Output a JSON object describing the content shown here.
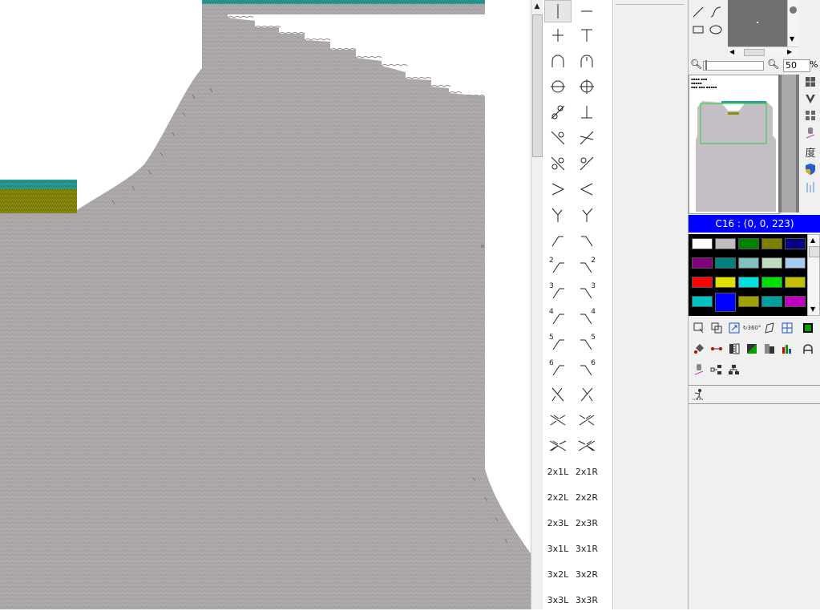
{
  "zoom": {
    "value": "50",
    "unit": "%"
  },
  "current_color": {
    "label": "C16 : (0, 0, 223)"
  },
  "symbol_palette": {
    "text_symbols": [
      "2x1L",
      "2x1R",
      "2x2L",
      "2x2R",
      "2x3L",
      "2x3R",
      "3x1L",
      "3x1R",
      "3x2L",
      "3x2R",
      "3x3L",
      "3x3R"
    ],
    "number_symbols": [
      "2",
      "2",
      "3",
      "3",
      "4",
      "4",
      "5",
      "5",
      "6",
      "6"
    ]
  },
  "side_tools": {
    "degree_label": "度"
  },
  "swatches": [
    "#ffffff",
    "#c0bcc0",
    "#008000",
    "#808000",
    "#000080",
    "#800080",
    "#008080",
    "#80c0c0",
    "#c0dcc0",
    "#a6caf0",
    "#ff0000",
    "#e0e000",
    "#00e0e0",
    "#00e000",
    "#c0c000",
    "#00c0c0",
    "#0000ff",
    "#a0a000",
    "#00a0a0",
    "#c000c0"
  ],
  "colors": {
    "knit": "#b3afb3",
    "knit_dark": "#9e9a9e",
    "border_teal": "#2aa39a",
    "border_olive": "#8c8f0a",
    "selection_blue": "#0000ff",
    "thumb_frame": "#2ecc40"
  }
}
